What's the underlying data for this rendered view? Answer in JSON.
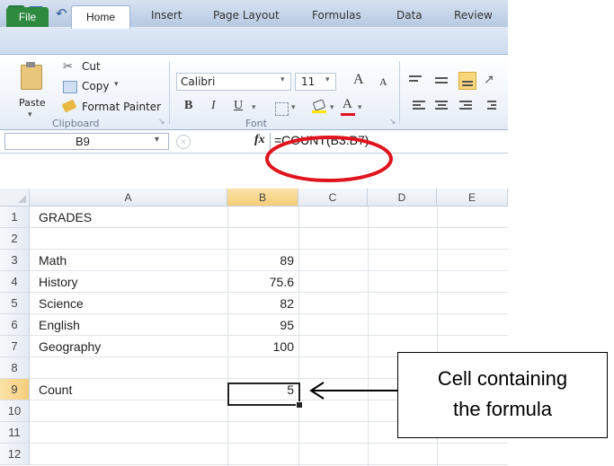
{
  "titlebar": {
    "app_logo": "X",
    "icons": [
      "excel-logo-icon",
      "save-icon",
      "undo-icon",
      "redo-icon",
      "qat-dropdown-icon"
    ]
  },
  "tabs": [
    "File",
    "Home",
    "Insert",
    "Page Layout",
    "Formulas",
    "Data",
    "Review"
  ],
  "ribbon": {
    "clipboard": {
      "paste": "Paste",
      "cut": "Cut",
      "copy": "Copy",
      "copy_arrow": "▾",
      "format_painter": "Format Painter",
      "label": "Clipboard"
    },
    "font": {
      "name": "Calibri",
      "size": "11",
      "bold": "B",
      "italic": "I",
      "underline": "U",
      "grow": "A",
      "shrink": "A",
      "font_color": "A",
      "label": "Font"
    }
  },
  "formula_bar": {
    "name_box": "B9",
    "fx": "fx",
    "formula": "=COUNT(B3:B7)"
  },
  "columns": [
    "A",
    "B",
    "C",
    "D",
    "E"
  ],
  "rows": [
    {
      "n": "1",
      "a": "GRADES",
      "b": ""
    },
    {
      "n": "2",
      "a": "",
      "b": ""
    },
    {
      "n": "3",
      "a": "Math",
      "b": "89"
    },
    {
      "n": "4",
      "a": "History",
      "b": "75.6"
    },
    {
      "n": "5",
      "a": "Science",
      "b": "82"
    },
    {
      "n": "6",
      "a": "English",
      "b": "95"
    },
    {
      "n": "7",
      "a": "Geography",
      "b": "100"
    },
    {
      "n": "8",
      "a": "",
      "b": ""
    },
    {
      "n": "9",
      "a": "Count",
      "b": "5"
    },
    {
      "n": "10",
      "a": "",
      "b": ""
    },
    {
      "n": "11",
      "a": "",
      "b": ""
    },
    {
      "n": "12",
      "a": "",
      "b": ""
    }
  ],
  "selected_cell": "B9",
  "annotation": {
    "line1": "Cell containing",
    "line2": "the formula"
  },
  "colors": {
    "highlight_red": "#e0141e",
    "file_tab": "#2d8a3e",
    "selected_col_header": "#f7d58b"
  }
}
